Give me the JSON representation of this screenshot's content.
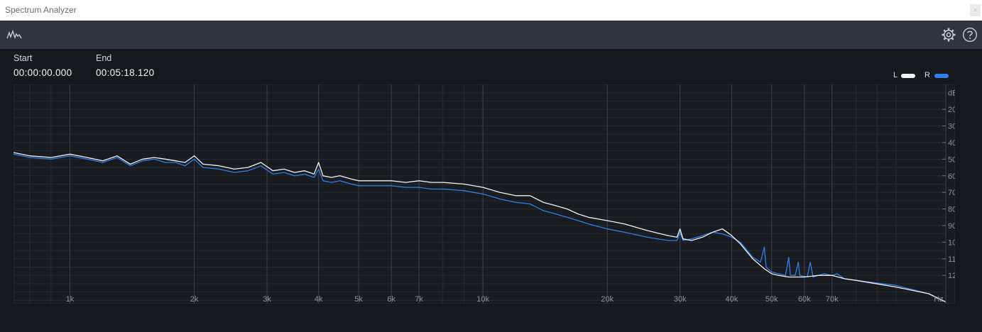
{
  "window": {
    "title": "Spectrum Analyzer",
    "close_glyph": "×"
  },
  "toolbar": {
    "app_icon": "spectrum-icon",
    "settings_icon": "gear-icon",
    "help_icon": "help-icon"
  },
  "range": {
    "start_label": "Start",
    "start_value": "00:00:00.000",
    "end_label": "End",
    "end_value": "00:05:18.120"
  },
  "colors": {
    "L": "#f2f2f2",
    "R": "#2f7fe8",
    "grid": "#262b33",
    "major_grid": "#3a4049"
  },
  "chart_data": {
    "type": "line",
    "x_scale": "log",
    "xlim": [
      730,
      132000
    ],
    "ylim": [
      -137,
      -5
    ],
    "x_unit": "Hz",
    "y_unit": "dB",
    "x_ticks": [
      {
        "v": 1000,
        "label": "1k"
      },
      {
        "v": 2000,
        "label": "2k"
      },
      {
        "v": 3000,
        "label": "3k"
      },
      {
        "v": 4000,
        "label": "4k"
      },
      {
        "v": 5000,
        "label": "5k"
      },
      {
        "v": 6000,
        "label": "6k"
      },
      {
        "v": 7000,
        "label": "7k"
      },
      {
        "v": 10000,
        "label": "10k"
      },
      {
        "v": 20000,
        "label": "20k"
      },
      {
        "v": 30000,
        "label": "30k"
      },
      {
        "v": 40000,
        "label": "40k"
      },
      {
        "v": 50000,
        "label": "50k"
      },
      {
        "v": 60000,
        "label": "60k"
      },
      {
        "v": 70000,
        "label": "70k"
      }
    ],
    "y_ticks": [
      {
        "v": -20,
        "label": "20"
      },
      {
        "v": -30,
        "label": "30"
      },
      {
        "v": -40,
        "label": "40"
      },
      {
        "v": -50,
        "label": "50"
      },
      {
        "v": -60,
        "label": "60"
      },
      {
        "v": -70,
        "label": "70"
      },
      {
        "v": -80,
        "label": "80"
      },
      {
        "v": -90,
        "label": "90"
      },
      {
        "v": -100,
        "label": "100"
      },
      {
        "v": -110,
        "label": "110"
      },
      {
        "v": -120,
        "label": "120"
      }
    ],
    "legend_placement": "top-right",
    "series": [
      {
        "name": "L",
        "points": [
          [
            730,
            -46
          ],
          [
            800,
            -48
          ],
          [
            900,
            -49
          ],
          [
            1000,
            -47
          ],
          [
            1100,
            -49
          ],
          [
            1200,
            -51
          ],
          [
            1300,
            -48
          ],
          [
            1400,
            -53
          ],
          [
            1500,
            -50
          ],
          [
            1600,
            -49
          ],
          [
            1700,
            -50
          ],
          [
            1800,
            -51
          ],
          [
            1900,
            -52
          ],
          [
            2000,
            -48
          ],
          [
            2100,
            -53
          ],
          [
            2300,
            -54
          ],
          [
            2500,
            -56
          ],
          [
            2700,
            -55
          ],
          [
            2900,
            -52
          ],
          [
            3100,
            -57
          ],
          [
            3300,
            -56
          ],
          [
            3500,
            -58
          ],
          [
            3700,
            -57
          ],
          [
            3900,
            -59
          ],
          [
            4000,
            -52
          ],
          [
            4100,
            -60
          ],
          [
            4300,
            -61
          ],
          [
            4500,
            -60
          ],
          [
            4800,
            -62
          ],
          [
            5000,
            -63
          ],
          [
            5500,
            -63
          ],
          [
            6000,
            -63
          ],
          [
            6500,
            -64
          ],
          [
            7000,
            -63
          ],
          [
            7500,
            -64
          ],
          [
            8000,
            -64
          ],
          [
            9000,
            -65
          ],
          [
            10000,
            -67
          ],
          [
            11000,
            -70
          ],
          [
            12000,
            -72
          ],
          [
            13000,
            -72
          ],
          [
            14000,
            -76
          ],
          [
            15000,
            -78
          ],
          [
            16000,
            -80
          ],
          [
            17000,
            -83
          ],
          [
            18000,
            -85
          ],
          [
            20000,
            -87
          ],
          [
            22000,
            -89
          ],
          [
            25000,
            -93
          ],
          [
            28000,
            -96
          ],
          [
            29500,
            -97
          ],
          [
            30000,
            -92
          ],
          [
            30500,
            -98
          ],
          [
            32000,
            -99
          ],
          [
            34000,
            -97
          ],
          [
            36000,
            -94
          ],
          [
            38000,
            -92
          ],
          [
            39000,
            -94
          ],
          [
            40000,
            -96
          ],
          [
            42000,
            -101
          ],
          [
            45000,
            -110
          ],
          [
            48000,
            -116
          ],
          [
            50000,
            -119
          ],
          [
            52000,
            -120
          ],
          [
            55000,
            -121
          ],
          [
            60000,
            -121
          ],
          [
            65000,
            -120
          ],
          [
            70000,
            -120
          ],
          [
            75000,
            -122
          ],
          [
            80000,
            -123
          ],
          [
            100000,
            -127
          ],
          [
            120000,
            -131
          ],
          [
            132000,
            -136
          ]
        ]
      },
      {
        "name": "R",
        "points": [
          [
            730,
            -47
          ],
          [
            800,
            -49
          ],
          [
            900,
            -50
          ],
          [
            1000,
            -48
          ],
          [
            1100,
            -50
          ],
          [
            1200,
            -52
          ],
          [
            1300,
            -49
          ],
          [
            1400,
            -54
          ],
          [
            1500,
            -51
          ],
          [
            1600,
            -50
          ],
          [
            1700,
            -52
          ],
          [
            1800,
            -52
          ],
          [
            1900,
            -54
          ],
          [
            2000,
            -50
          ],
          [
            2100,
            -55
          ],
          [
            2300,
            -56
          ],
          [
            2500,
            -58
          ],
          [
            2700,
            -57
          ],
          [
            2900,
            -54
          ],
          [
            3100,
            -59
          ],
          [
            3300,
            -58
          ],
          [
            3500,
            -60
          ],
          [
            3700,
            -59
          ],
          [
            3900,
            -61
          ],
          [
            4000,
            -56
          ],
          [
            4100,
            -63
          ],
          [
            4300,
            -64
          ],
          [
            4500,
            -63
          ],
          [
            4800,
            -65
          ],
          [
            5000,
            -66
          ],
          [
            5500,
            -66
          ],
          [
            6000,
            -66
          ],
          [
            6500,
            -67
          ],
          [
            7000,
            -67
          ],
          [
            7500,
            -68
          ],
          [
            8000,
            -68
          ],
          [
            9000,
            -69
          ],
          [
            10000,
            -71
          ],
          [
            11000,
            -74
          ],
          [
            12000,
            -76
          ],
          [
            13000,
            -77
          ],
          [
            14000,
            -81
          ],
          [
            15000,
            -83
          ],
          [
            16000,
            -85
          ],
          [
            17000,
            -87
          ],
          [
            18000,
            -89
          ],
          [
            20000,
            -92
          ],
          [
            22000,
            -94
          ],
          [
            25000,
            -97
          ],
          [
            28000,
            -99
          ],
          [
            29500,
            -99
          ],
          [
            30000,
            -94
          ],
          [
            30500,
            -99
          ],
          [
            32000,
            -98
          ],
          [
            34000,
            -96
          ],
          [
            36000,
            -94
          ],
          [
            38000,
            -95
          ],
          [
            39000,
            -96
          ],
          [
            40000,
            -97
          ],
          [
            42000,
            -100
          ],
          [
            45000,
            -109
          ],
          [
            47000,
            -112
          ],
          [
            48000,
            -103
          ],
          [
            48500,
            -115
          ],
          [
            50000,
            -118
          ],
          [
            52000,
            -119
          ],
          [
            54000,
            -120
          ],
          [
            55000,
            -109
          ],
          [
            55500,
            -120
          ],
          [
            57000,
            -120
          ],
          [
            58000,
            -112
          ],
          [
            58500,
            -120
          ],
          [
            61000,
            -121
          ],
          [
            62000,
            -112
          ],
          [
            63000,
            -121
          ],
          [
            67000,
            -119
          ],
          [
            70000,
            -120
          ],
          [
            72000,
            -119
          ],
          [
            75000,
            -122
          ],
          [
            80000,
            -123
          ],
          [
            100000,
            -126
          ],
          [
            120000,
            -131
          ],
          [
            132000,
            -136
          ]
        ]
      }
    ]
  }
}
